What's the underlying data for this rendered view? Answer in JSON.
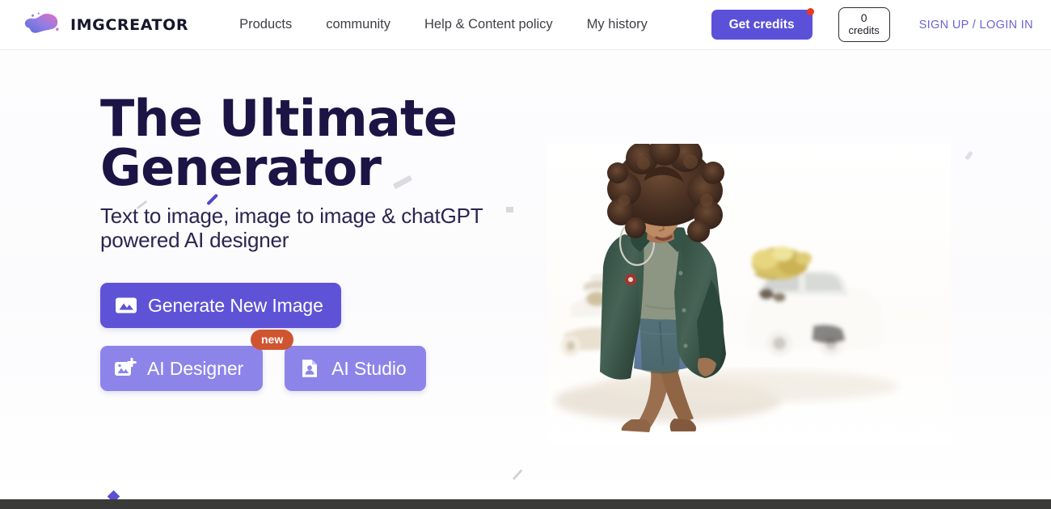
{
  "brand": {
    "name": "IMGCREATOR",
    "logo_icon": "blob-logo-icon"
  },
  "nav": {
    "links": [
      {
        "label": "Products",
        "name": "nav-link-products"
      },
      {
        "label": "community",
        "name": "nav-link-community"
      },
      {
        "label": "Help & Content policy",
        "name": "nav-link-help-content-policy"
      },
      {
        "label": "My history",
        "name": "nav-link-my-history"
      }
    ],
    "get_credits_label": "Get credits",
    "notification_dot_color": "#e8391f",
    "credits": {
      "count": "0",
      "label": "credits"
    },
    "auth_label": "SIGN UP / LOGIN IN",
    "auth_color": "#6c63d6"
  },
  "hero": {
    "headline_line1": "The Ultimate",
    "headline_line2": "Generator",
    "headline_color": "#1c1445",
    "subheadline_line1": "Text to image, image to image & chatGPT",
    "subheadline_line2": "powered AI designer",
    "buttons": {
      "generate": {
        "label": "Generate New Image",
        "icon": "image-icon",
        "color": "#5e53d6"
      },
      "designer": {
        "label": "AI Designer",
        "icon": "image-plus-icon",
        "color": "#8d84ea",
        "badge": "new",
        "badge_color": "#cf5430"
      },
      "studio": {
        "label": "AI Studio",
        "icon": "document-person-icon",
        "color": "#8d84ea"
      }
    },
    "image_alt": "woman-in-green-jacket-hero-photo"
  }
}
